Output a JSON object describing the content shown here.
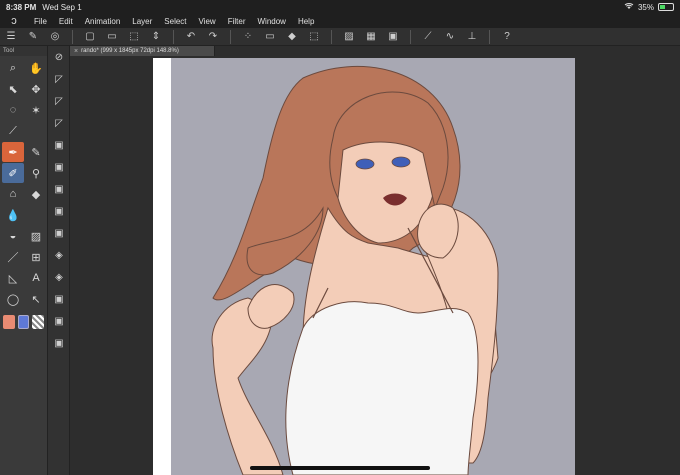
{
  "status_bar": {
    "time": "8:38 PM",
    "date": "Wed Sep 1",
    "battery": "35%",
    "battery_level": 0.35
  },
  "menu": {
    "app_icon": "clip-studio-logo",
    "items": [
      "File",
      "Edit",
      "Animation",
      "Layer",
      "Select",
      "View",
      "Filter",
      "Window",
      "Help"
    ]
  },
  "toolbar": {
    "buttons": [
      "menu-icon",
      "brush-settings-icon",
      "view-icon",
      "new-icon",
      "open-icon",
      "save-icon",
      "undo-icon",
      "redo-icon",
      "select-icon",
      "fill-icon",
      "transform-icon",
      "ruler-icon",
      "help-icon"
    ]
  },
  "tool_palette": {
    "title": "Tool",
    "tools": [
      "zoom-icon",
      "hand-icon",
      "move-icon",
      "select-icon",
      "lasso-icon",
      "magic-wand-icon",
      "eyedropper-icon",
      "pen-icon",
      "pencil-icon",
      "brush-icon",
      "airbrush-icon",
      "eraser-icon",
      "blend-icon",
      "fill-icon",
      "gradient-icon",
      "shape-icon",
      "frame-icon",
      "ruler-icon",
      "text-icon",
      "balloon-icon",
      "correct-line-icon"
    ]
  },
  "colors": {
    "main": "#e98b73",
    "sub": "#5f79d6"
  },
  "document": {
    "tab_label": "rando* (999 x 1845px 72dpi 148.8%)"
  },
  "canvas_palette": {
    "bg_gray": "#a8a8b3",
    "skin": "#f3cdb8",
    "hair": "#b9765a",
    "dress": "#f6f6f6",
    "eyes": "#3f5fb8",
    "lips": "#7a2e2e",
    "outline": "#6b4a3e"
  }
}
